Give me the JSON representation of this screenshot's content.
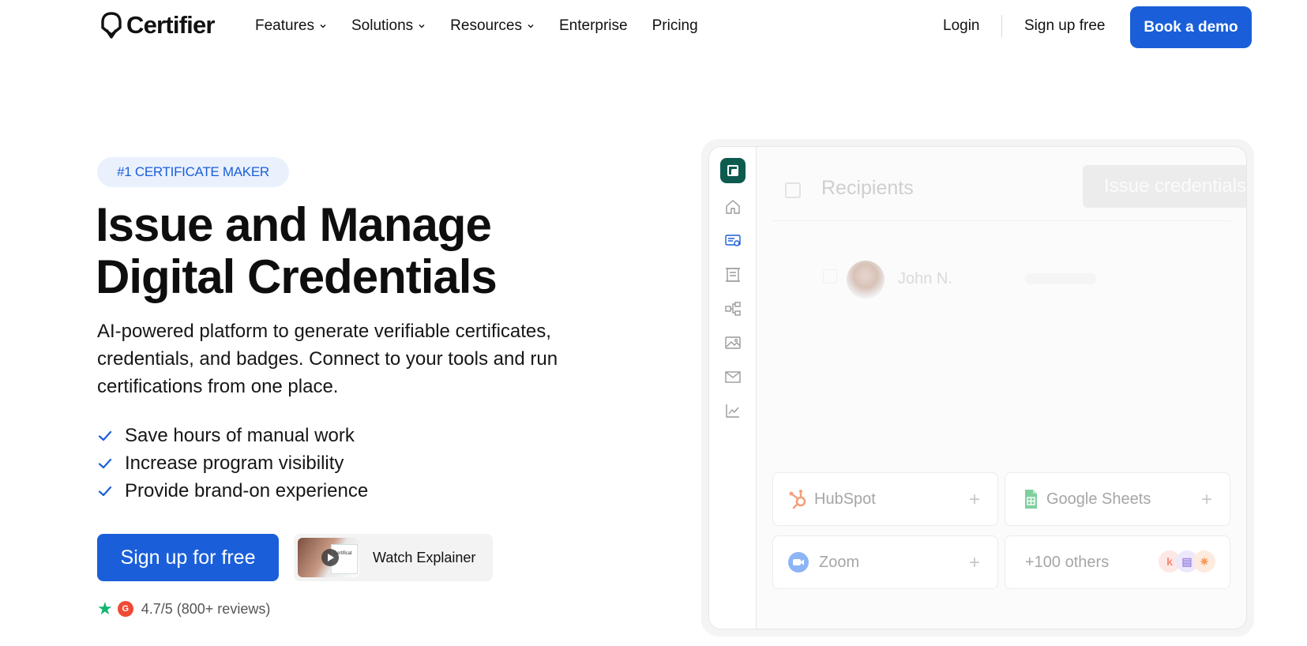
{
  "nav": {
    "logo_text": "Certifier",
    "links": [
      {
        "label": "Features",
        "dropdown": true
      },
      {
        "label": "Solutions",
        "dropdown": true
      },
      {
        "label": "Resources",
        "dropdown": true
      },
      {
        "label": "Enterprise",
        "dropdown": false
      },
      {
        "label": "Pricing",
        "dropdown": false
      }
    ],
    "login": "Login",
    "signup": "Sign up free",
    "demo": "Book a demo"
  },
  "hero": {
    "badge": "#1 CERTIFICATE MAKER",
    "headline_line1": "Issue and Manage",
    "headline_line2": "Digital Credentials",
    "subtext": "AI-powered platform to generate verifiable certificates, credentials, and badges. Connect to your tools and run certifications from one place.",
    "features": [
      "Save hours of manual work",
      "Increase program visibility",
      "Provide brand-on experience"
    ],
    "cta": "Sign up for free",
    "watch": "Watch Explainer",
    "thumb_text": "Certificat",
    "rating": "4.7/5 (800+ reviews)",
    "g2_label": "G"
  },
  "mock": {
    "recipients_title": "Recipients",
    "issue_button": "Issue credentials",
    "recipient_name": "John N.",
    "integrations": [
      {
        "name": "HubSpot",
        "icon": "hubspot-icon"
      },
      {
        "name": "Google Sheets",
        "icon": "google-sheets-icon"
      },
      {
        "name": "Zoom",
        "icon": "zoom-icon"
      },
      {
        "name": "+100 others",
        "icon": "others-icons"
      }
    ],
    "plus": "+"
  },
  "colors": {
    "primary": "#1a5fd9",
    "brand_green": "#0d5b4f",
    "star": "#0fb570",
    "g2": "#ef4a35"
  }
}
